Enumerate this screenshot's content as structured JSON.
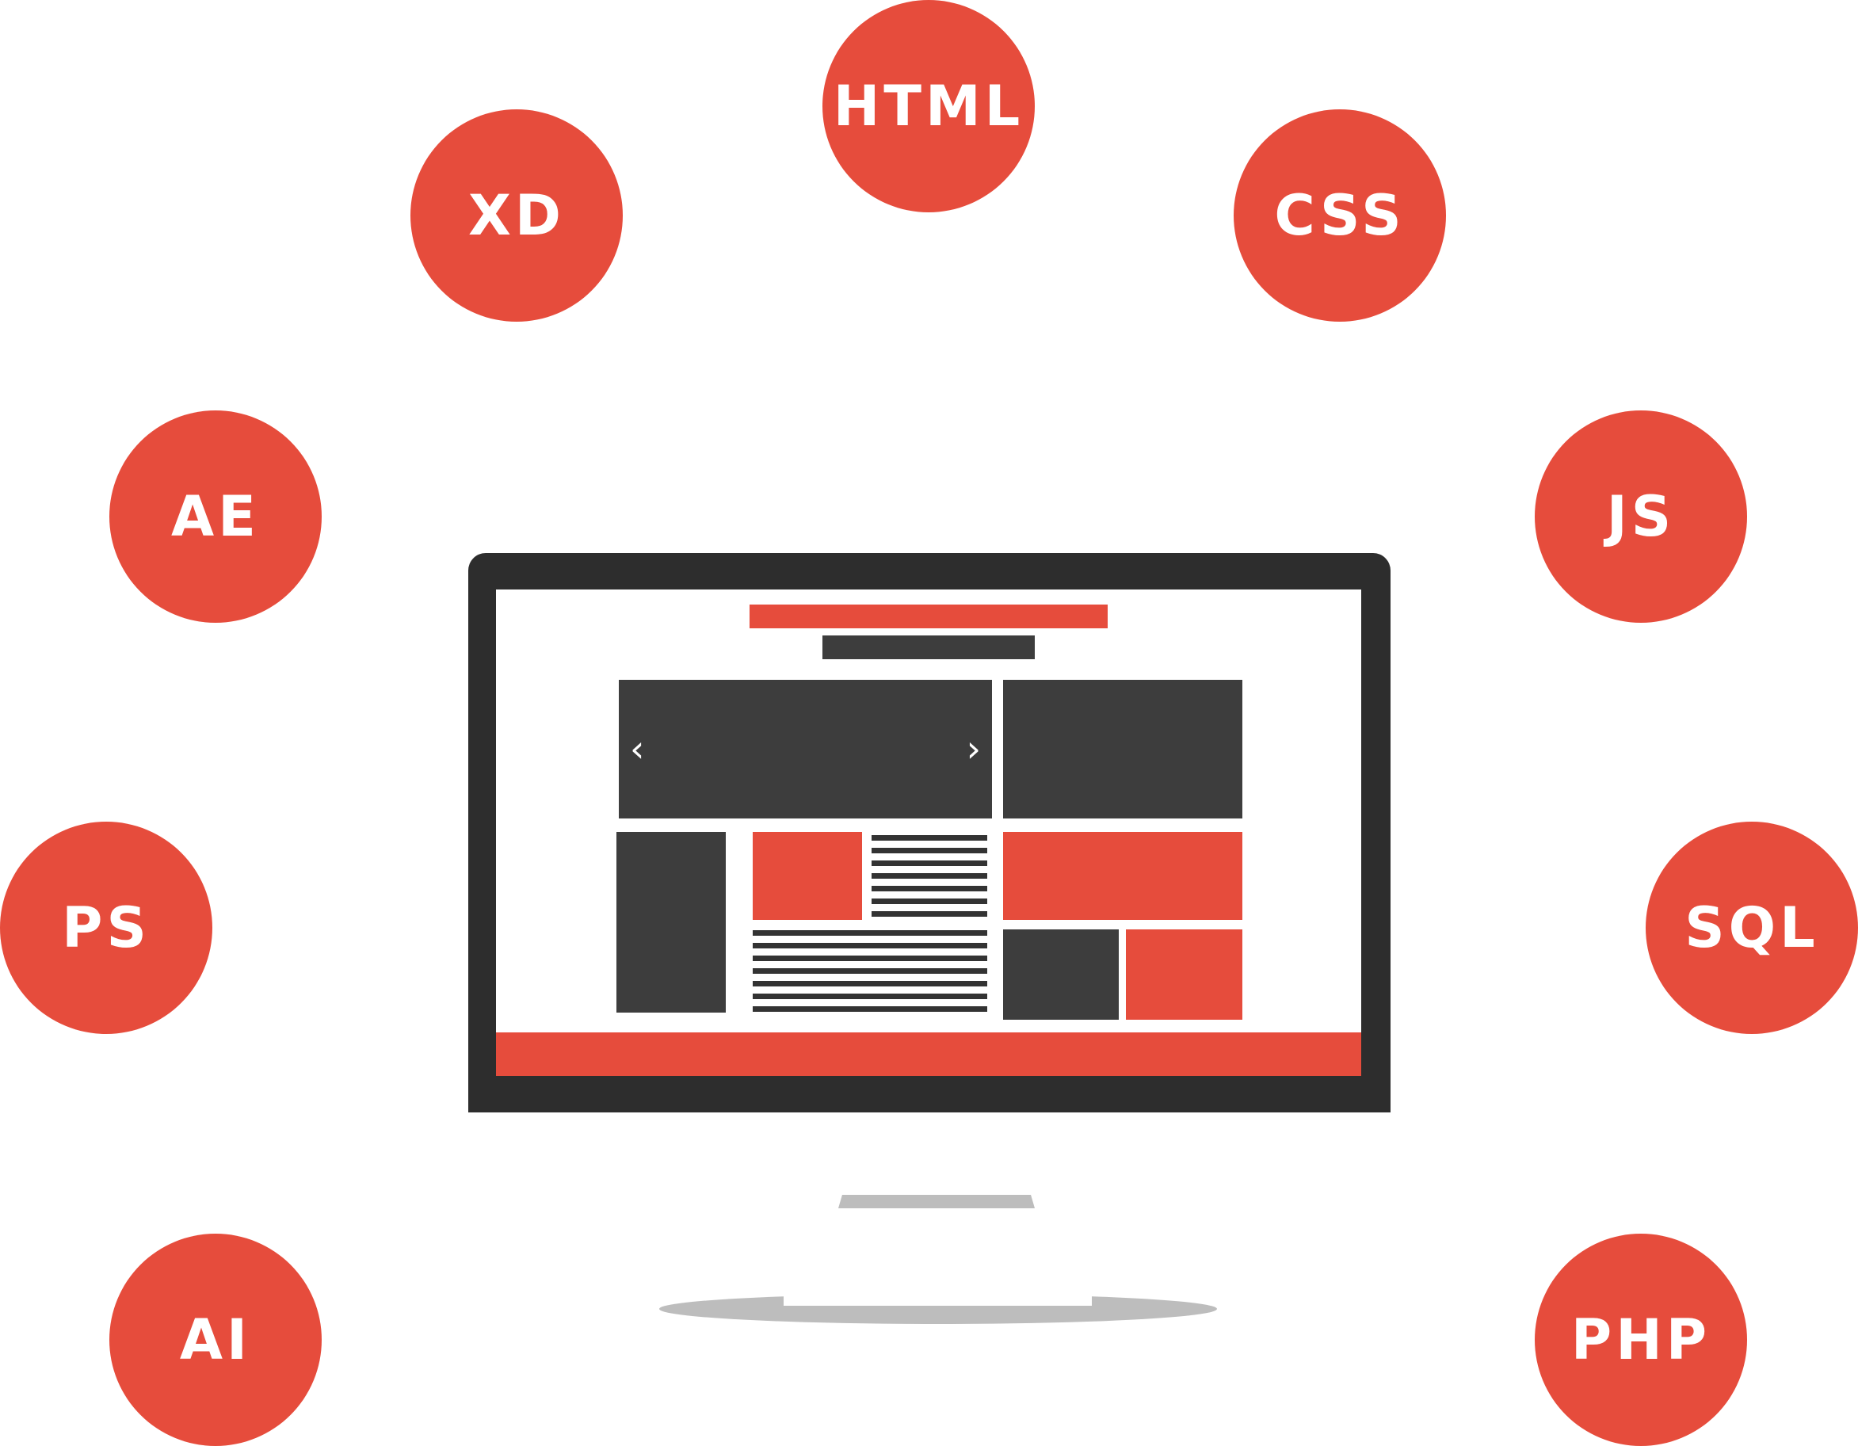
{
  "colors": {
    "accent": "#e64c3c",
    "monitor_frame": "#2d2d2d",
    "content_block": "#3d3d3d",
    "stand": "#bdbdbd",
    "label_text": "#ffffff"
  },
  "skills": [
    {
      "label": "HTML",
      "icon": "html-badge"
    },
    {
      "label": "XD",
      "icon": "xd-badge"
    },
    {
      "label": "CSS",
      "icon": "css-badge"
    },
    {
      "label": "AE",
      "icon": "ae-badge"
    },
    {
      "label": "JS",
      "icon": "js-badge"
    },
    {
      "label": "PS",
      "icon": "ps-badge"
    },
    {
      "label": "SQL",
      "icon": "sql-badge"
    },
    {
      "label": "AI",
      "icon": "ai-badge"
    },
    {
      "label": "PHP",
      "icon": "php-badge"
    }
  ],
  "monitor": {
    "slider_prev_icon": "chevron-left-icon",
    "slider_next_icon": "chevron-right-icon",
    "slider_prev_glyph": "‹",
    "slider_next_glyph": "›"
  }
}
